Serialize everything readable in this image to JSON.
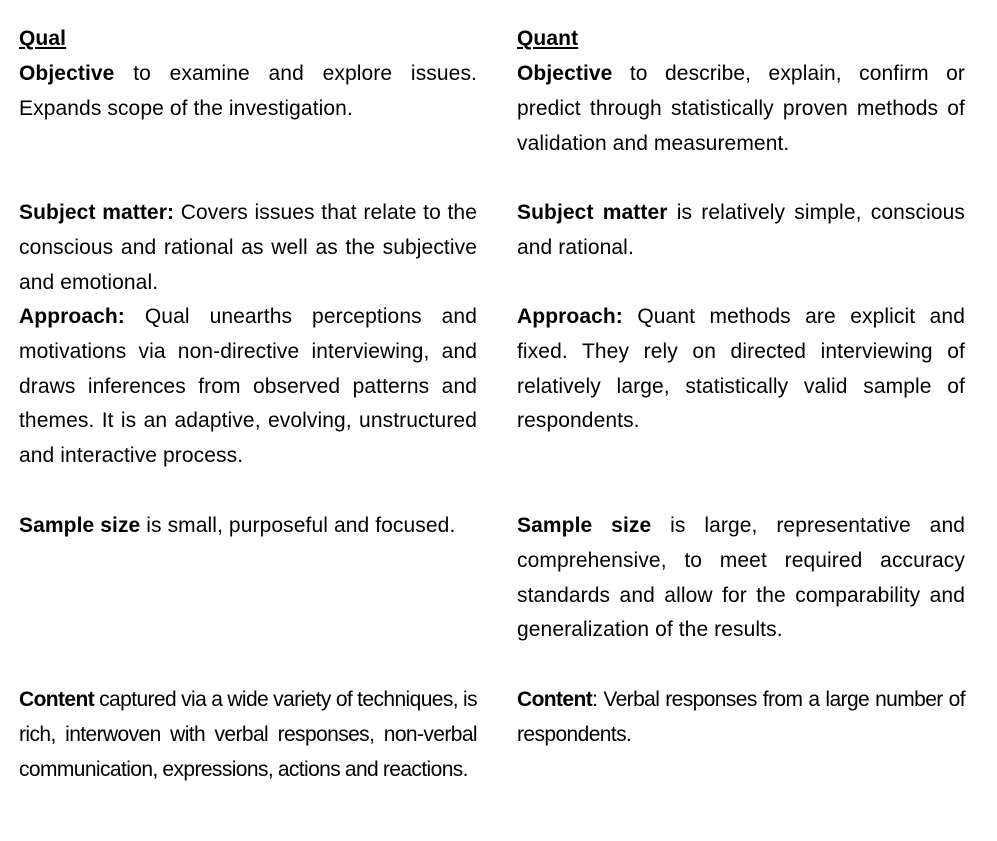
{
  "document": {
    "qual": {
      "heading": "Qual",
      "sections": [
        {
          "label": "Objective",
          "text": " to examine and explore issues. Expands scope of the investigation."
        },
        {
          "label": "Subject matter:",
          "text": " Covers issues that relate to the conscious and rational as well as the subjective and emotional."
        },
        {
          "label": "Approach:",
          "text": " Qual unearths perceptions and motivations via non-directive interviewing, and draws inferences from observed patterns and themes.  It is an adaptive, evolving, unstructured and interactive process."
        },
        {
          "label": "Sample size",
          "text": " is small, purposeful and focused."
        },
        {
          "label": "Content",
          "text": " captured via a wide variety of techniques, is rich, interwoven with verbal responses, non-verbal communication, expressions, actions and reactions."
        }
      ]
    },
    "quant": {
      "heading": "Quant",
      "sections": [
        {
          "label": "Objective",
          "text": " to describe, explain, confirm or predict through statistically proven methods of validation and measurement."
        },
        {
          "label": "Subject matter",
          "text": " is relatively simple, conscious and rational."
        },
        {
          "label": "Approach:",
          "text": " Quant methods are explicit and fixed. They rely on directed interviewing of relatively large, statistically valid sample of  respondents."
        },
        {
          "label": "Sample size",
          "text": " is large, representative and comprehensive, to meet required accuracy standards and allow for the comparability  and generalization of the results."
        },
        {
          "label": "Content",
          "text": ": Verbal responses from a large number of  respondents."
        }
      ]
    }
  }
}
